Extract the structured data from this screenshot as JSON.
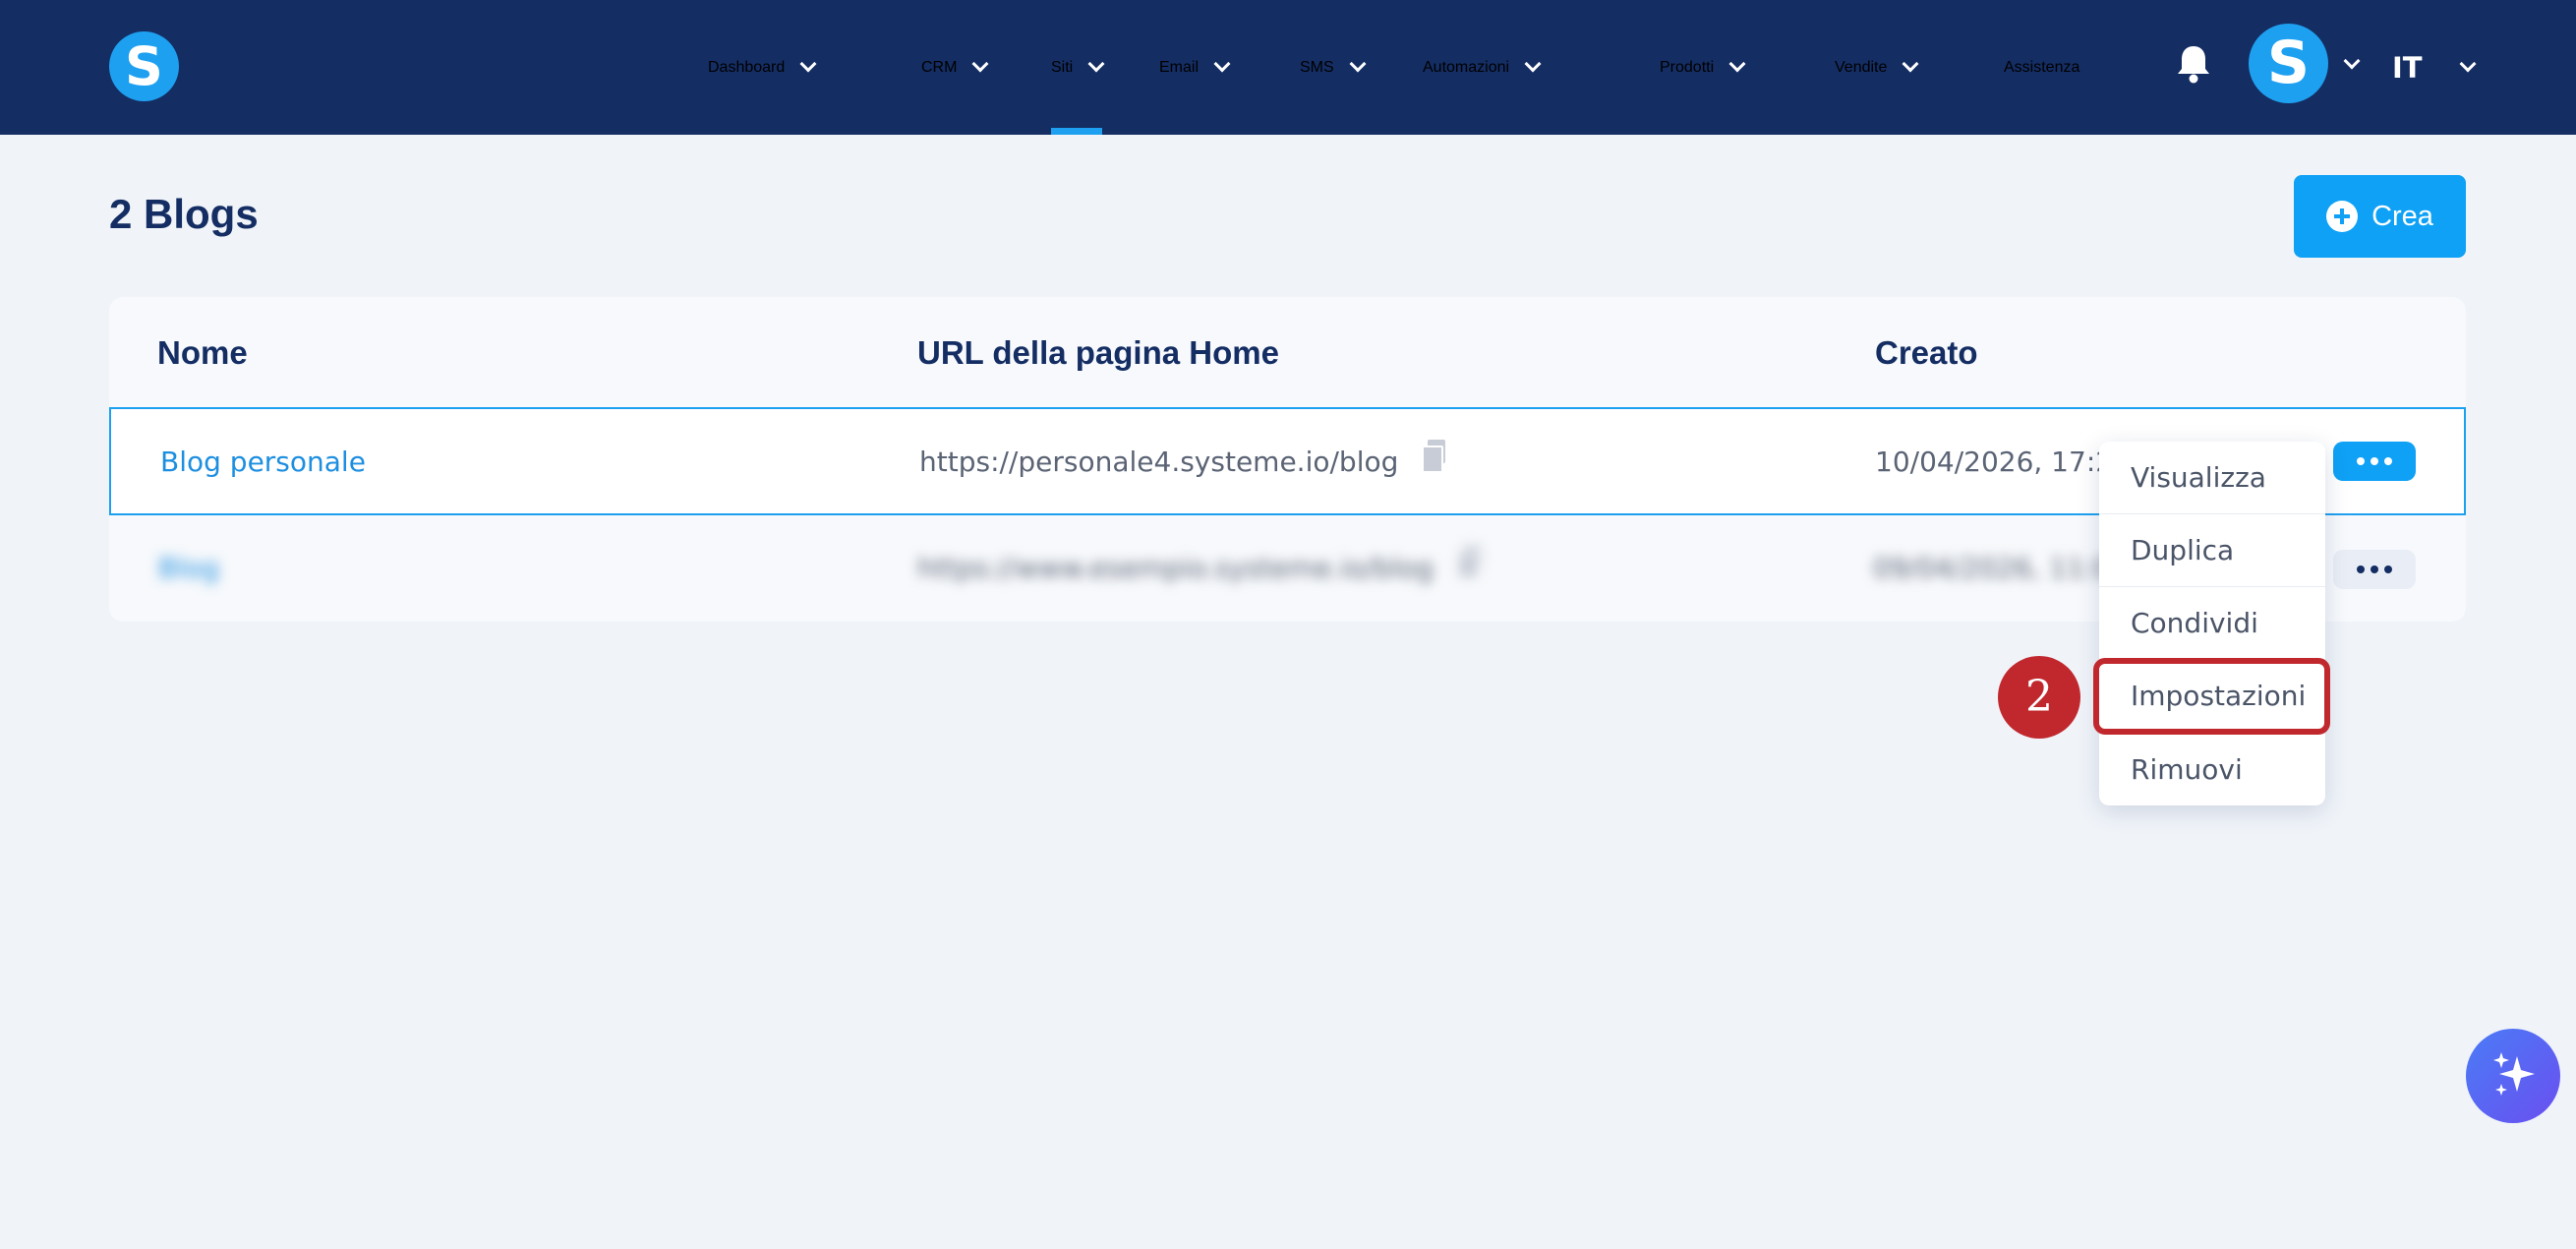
{
  "nav": {
    "logo": "S",
    "items": [
      {
        "label": "Dashboard"
      },
      {
        "label": "CRM"
      },
      {
        "label": "Siti",
        "active": true
      },
      {
        "label": "Email"
      },
      {
        "label": "SMS"
      },
      {
        "label": "Automazioni"
      },
      {
        "label": "Prodotti"
      },
      {
        "label": "Vendite"
      },
      {
        "label": "Assistenza"
      }
    ],
    "avatar": "S",
    "language": "IT"
  },
  "page": {
    "title": "2 Blogs",
    "create_label": "Crea"
  },
  "table": {
    "headers": [
      "Nome",
      "URL della pagina Home",
      "Creato"
    ],
    "rows": [
      {
        "name": "Blog personale",
        "url": "https://personale4.systeme.io/blog",
        "created": "10/04/2026, 17:24"
      },
      {
        "name": "Blog",
        "url": "https://www.esempio.systeme.io/blog",
        "created": "09/04/2026, 11:02"
      }
    ]
  },
  "menu": {
    "items": [
      "Visualizza",
      "Duplica",
      "Condividi",
      "Impostazioni",
      "Rimuovi"
    ]
  },
  "annotation": {
    "step": "2"
  },
  "colors": {
    "nav_bg": "#142d63",
    "accent": "#0fa1f5",
    "highlight": "#c0282d"
  }
}
